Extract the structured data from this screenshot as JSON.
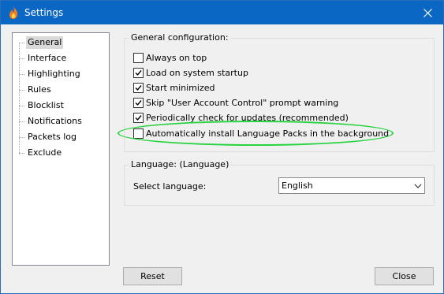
{
  "window": {
    "title": "Settings"
  },
  "sidebar": {
    "items": [
      {
        "label": "General",
        "selected": true
      },
      {
        "label": "Interface",
        "selected": false
      },
      {
        "label": "Highlighting",
        "selected": false
      },
      {
        "label": "Rules",
        "selected": false
      },
      {
        "label": "Blocklist",
        "selected": false
      },
      {
        "label": "Notifications",
        "selected": false
      },
      {
        "label": "Packets log",
        "selected": false
      },
      {
        "label": "Exclude",
        "selected": false
      }
    ]
  },
  "general": {
    "title": "General configuration:",
    "options": [
      {
        "label": "Always on top",
        "checked": false
      },
      {
        "label": "Load on system startup",
        "checked": true
      },
      {
        "label": "Start minimized",
        "checked": true
      },
      {
        "label": "Skip \"User Account Control\" prompt warning",
        "checked": true
      },
      {
        "label": "Periodically check for updates (recommended)",
        "checked": true
      },
      {
        "label": "Automatically install Language Packs in the background",
        "checked": false
      }
    ]
  },
  "language": {
    "title": "Language: (Language)",
    "select_label": "Select language:",
    "selected": "English"
  },
  "buttons": {
    "reset": "Reset",
    "close": "Close"
  },
  "colors": {
    "titlebar": "#0b67c4",
    "highlight": "#27d33f",
    "icon_flame": "#f47a20"
  }
}
